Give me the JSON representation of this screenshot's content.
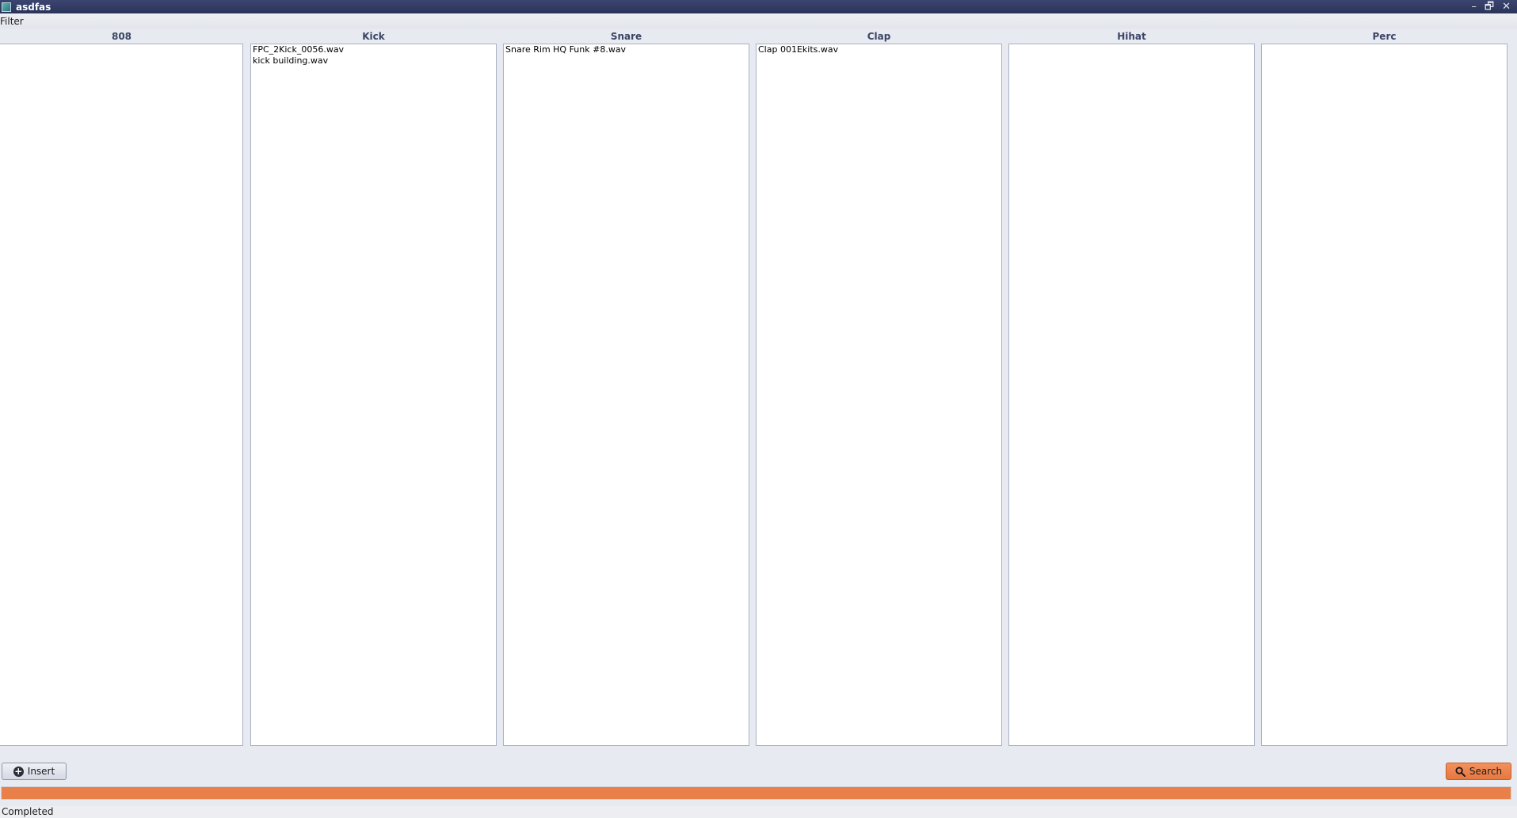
{
  "window": {
    "title": "asdfas",
    "controls": {
      "minimize": "–",
      "restore": "🗗",
      "close": "✕"
    }
  },
  "menu": {
    "items": [
      "Filter"
    ]
  },
  "columns": [
    {
      "header": "808",
      "items": []
    },
    {
      "header": "Kick",
      "items": [
        "FPC_2Kick_0056.wav",
        "kick building.wav"
      ]
    },
    {
      "header": "Snare",
      "items": [
        "Snare Rim HQ Funk #8.wav"
      ]
    },
    {
      "header": "Clap",
      "items": [
        "Clap 001Ekits.wav"
      ]
    },
    {
      "header": "Hihat",
      "items": []
    },
    {
      "header": "Perc",
      "items": []
    }
  ],
  "buttons": {
    "insert_label": "Insert",
    "search_label": "Search"
  },
  "progress": {
    "value_percent": 100,
    "color": "#e9804a"
  },
  "status": {
    "text": "Completed"
  },
  "icons": {
    "app": "app-icon",
    "insert": "plus-circle-icon",
    "search": "search-icon"
  }
}
